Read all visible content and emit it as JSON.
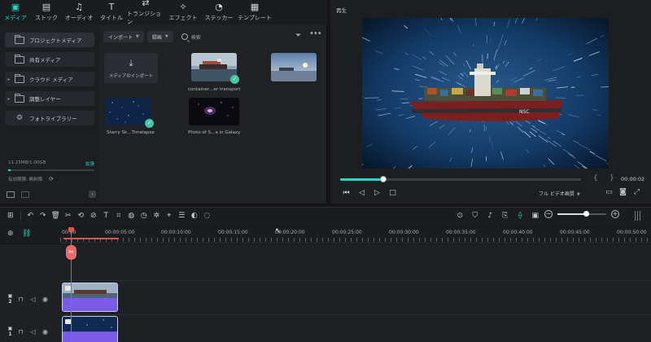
{
  "top_tabs": [
    {
      "label": "メディア",
      "icon": "media-icon",
      "glyph": "▣"
    },
    {
      "label": "ストック",
      "icon": "stock-icon",
      "glyph": "▤"
    },
    {
      "label": "オーディオ",
      "icon": "audio-icon",
      "glyph": "♫"
    },
    {
      "label": "タイトル",
      "icon": "title-icon",
      "glyph": "T"
    },
    {
      "label": "トランジション",
      "icon": "transition-icon",
      "glyph": "⇄"
    },
    {
      "label": "エフェクト",
      "icon": "effect-icon",
      "glyph": "✧"
    },
    {
      "label": "ステッカー",
      "icon": "sticker-icon",
      "glyph": "◔"
    },
    {
      "label": "テンプレート",
      "icon": "template-icon",
      "glyph": "▦"
    }
  ],
  "sidebar": {
    "items": [
      {
        "label": "プロジェクトメディア"
      },
      {
        "label": "共有メディア"
      },
      {
        "label": "クラウド メディア"
      },
      {
        "label": "調整レイヤー"
      },
      {
        "label": "フォトライブラリー"
      }
    ],
    "storage_used": "11.23MB/1.00GB",
    "storage_tag": "拡張",
    "storage_fraction": 0.011,
    "expiry": "有効期限: 無制限"
  },
  "media": {
    "import_filter": "インポート",
    "sort_filter": "録画",
    "search_placeholder": "検索",
    "import_card_label": "メディアのインポート",
    "items": [
      {
        "label": "container…er transport",
        "checked": true
      },
      {
        "label": "",
        "checked": false
      },
      {
        "label": "Starry Sk…Timelapse",
        "checked": true
      },
      {
        "label": "Photo of S…a in Galaxy",
        "checked": false
      }
    ]
  },
  "preview": {
    "title": "再生",
    "timecode": "00:00:02",
    "progress": 0.18,
    "quality": "フル ビデオ画質",
    "ship_text": "NSC"
  },
  "timeline": {
    "ruler_labels": [
      "00:00",
      "00:00:05:00",
      "00:00:10:00",
      "00:00:15:00",
      "00:00:20:00",
      "00:00:25:00",
      "00:00:30:00",
      "00:00:35:00",
      "00:00:40:00",
      "00:00:45:00",
      "00:00:50:00"
    ],
    "zoom_level": 0.58,
    "tracks": [
      {
        "number": "2"
      },
      {
        "number": "1"
      }
    ]
  },
  "colors": {
    "accent": "#27d8c5",
    "playhead": "#e2524f",
    "clip": "#6c52d6"
  }
}
